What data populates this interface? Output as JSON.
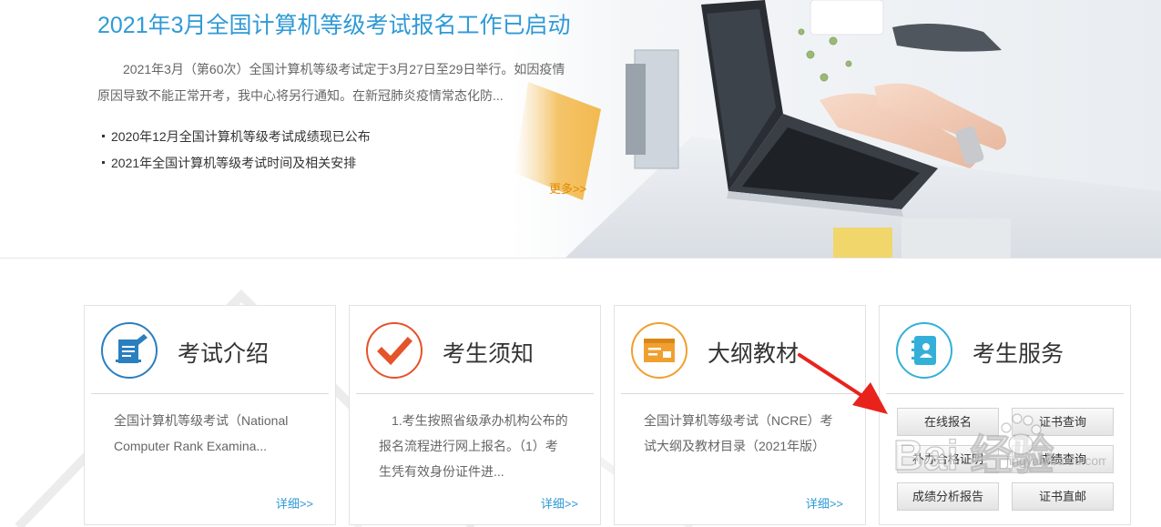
{
  "banner": {
    "headline": "2021年3月全国计算机等级考试报名工作已启动",
    "summary": "2021年3月（第60次）全国计算机等级考试定于3月27日至29日举行。如因疫情原因导致不能正常开考，我中心将另行通知。在新冠肺炎疫情常态化防...",
    "news": [
      "2020年12月全国计算机等级考试成绩现已公布",
      "2021年全国计算机等级考试时间及相关安排"
    ],
    "more_label": "更多>>"
  },
  "cards": [
    {
      "title": "考试介绍",
      "icon": "document-edit-icon",
      "accent": "#2a7fc0",
      "text": "全国计算机等级考试（National Computer Rank Examina...",
      "detail_label": "详细>>"
    },
    {
      "title": "考生须知",
      "icon": "checkmark-icon",
      "accent": "#e5532a",
      "text": "1.考生按照省级承办机构公布的报名流程进行网上报名。（1）考生凭有效身份证件进...",
      "detail_label": "详细>>"
    },
    {
      "title": "大纲教材",
      "icon": "syllabus-window-icon",
      "accent": "#f0a030",
      "text": "全国计算机等级考试（NCRE）考试大纲及教材目录（2021年版）",
      "detail_label": "详细>>"
    },
    {
      "title": "考生服务",
      "icon": "contact-book-icon",
      "accent": "#34b0d8",
      "services": [
        "在线报名",
        "证书查询",
        "补办合格证明",
        "成绩查询",
        "成绩分析报告",
        "证书直邮"
      ]
    }
  ],
  "colors": {
    "headline": "#2f9ad6",
    "link": "#2f9ad6",
    "more": "#e08a00",
    "annotation_arrow": "#e8231c"
  },
  "watermark": {
    "text": "Bai 经验",
    "url_text": "jingyan.baidu.com"
  }
}
